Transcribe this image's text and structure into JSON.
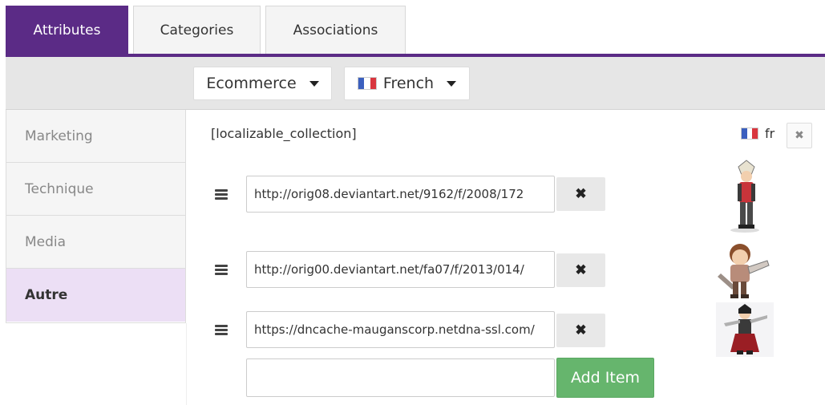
{
  "tabs": [
    {
      "label": "Attributes",
      "active": true
    },
    {
      "label": "Categories",
      "active": false
    },
    {
      "label": "Associations",
      "active": false
    }
  ],
  "scope": {
    "label": "Ecommerce"
  },
  "locale": {
    "label": "French",
    "flag": "fr-flag-icon"
  },
  "sidebar": {
    "items": [
      {
        "label": "Marketing",
        "active": false
      },
      {
        "label": "Technique",
        "active": false
      },
      {
        "label": "Media",
        "active": false
      },
      {
        "label": "Autre",
        "active": true
      }
    ]
  },
  "field": {
    "label": "[localizable_collection]",
    "locale_code": "fr",
    "remove_icon": "close-icon",
    "items": [
      {
        "url": "http://orig08.deviantart.net/9162/f/2008/172",
        "remove_icon": "close-icon"
      },
      {
        "url": "http://orig00.deviantart.net/fa07/f/2013/014/",
        "remove_icon": "close-icon"
      },
      {
        "url": "https://dncache-mauganscorp.netdna-ssl.com/",
        "remove_icon": "close-icon"
      }
    ],
    "new_item_value": "",
    "add_label": "Add Item"
  },
  "colors": {
    "brand": "#5b2b86",
    "active_sidebar": "#ecdff5",
    "add_button": "#66b56d"
  }
}
